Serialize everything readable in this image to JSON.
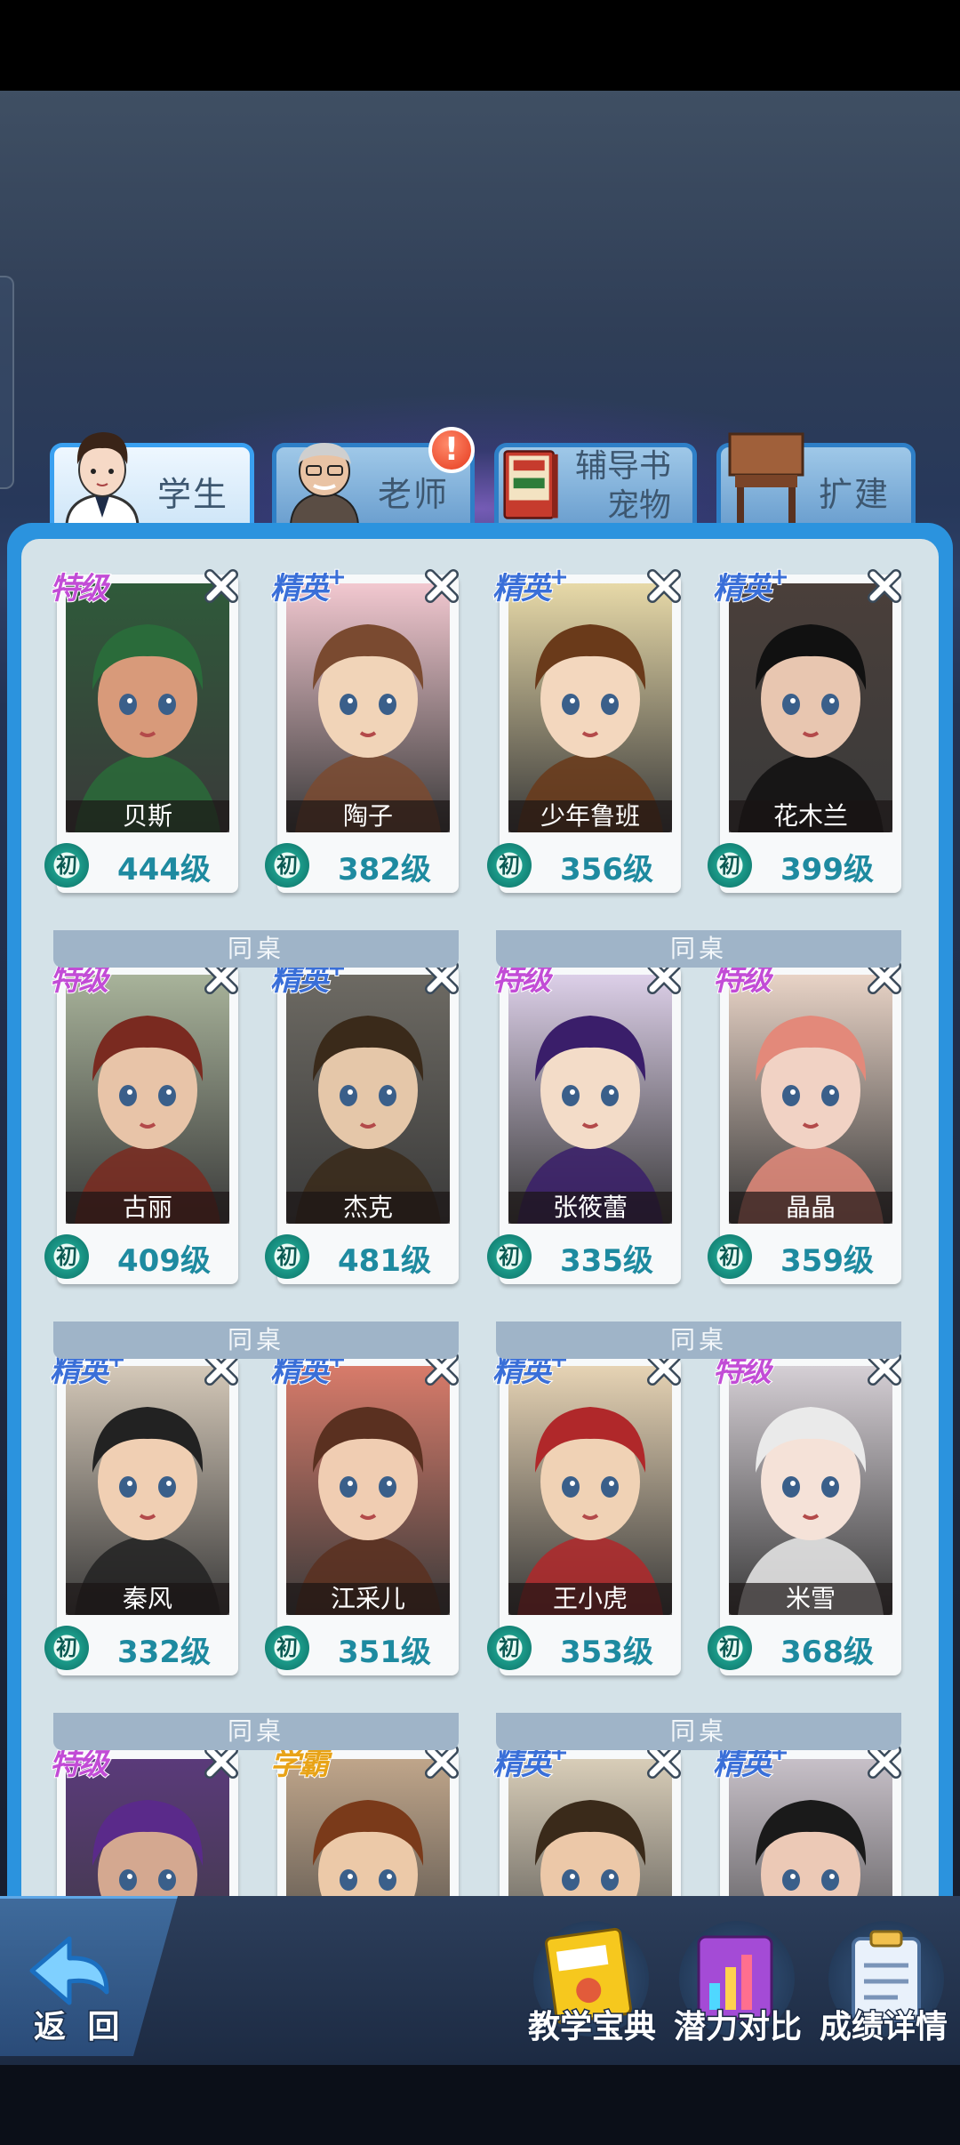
{
  "tabs": [
    {
      "label": "学生",
      "active": true
    },
    {
      "label": "老师",
      "alert": "!"
    },
    {
      "label_line1": "辅导书",
      "label_line2": "宠物"
    },
    {
      "label": "扩建"
    }
  ],
  "colors": {
    "panel": "#2b93de",
    "panel_inner": "#d4e2e8",
    "rank_tj": "#c24cd6",
    "rank_jy": "#3a6fd8",
    "rank_xb": "#e8a317",
    "level_text": "#1e8aa0"
  },
  "students": [
    {
      "name": "贝斯",
      "level": "444级",
      "tier": "初",
      "rank": "特级"
    },
    {
      "name": "陶子",
      "level": "382级",
      "tier": "初",
      "rank": "精英+"
    },
    {
      "name": "少年鲁班",
      "level": "356级",
      "tier": "初",
      "rank": "精英+"
    },
    {
      "name": "花木兰",
      "level": "399级",
      "tier": "初",
      "rank": "精英+"
    },
    {
      "name": "古丽",
      "level": "409级",
      "tier": "初",
      "rank": "特级"
    },
    {
      "name": "杰克",
      "level": "481级",
      "tier": "初",
      "rank": "精英+"
    },
    {
      "name": "张筱蕾",
      "level": "335级",
      "tier": "初",
      "rank": "特级"
    },
    {
      "name": "晶晶",
      "level": "359级",
      "tier": "初",
      "rank": "特级"
    },
    {
      "name": "秦风",
      "level": "332级",
      "tier": "初",
      "rank": "精英+"
    },
    {
      "name": "江采儿",
      "level": "351级",
      "tier": "初",
      "rank": "精英+"
    },
    {
      "name": "王小虎",
      "level": "353级",
      "tier": "初",
      "rank": "精英+"
    },
    {
      "name": "米雪",
      "level": "368级",
      "tier": "初",
      "rank": "特级"
    },
    {
      "rank": "特级"
    },
    {
      "rank": "学霸"
    },
    {
      "rank": "精英+"
    },
    {
      "rank": "精英+"
    }
  ],
  "desk_label": "同桌",
  "bottom": {
    "back": "返 回",
    "tools": [
      "教学宝典",
      "潜力对比",
      "成绩详情"
    ]
  }
}
